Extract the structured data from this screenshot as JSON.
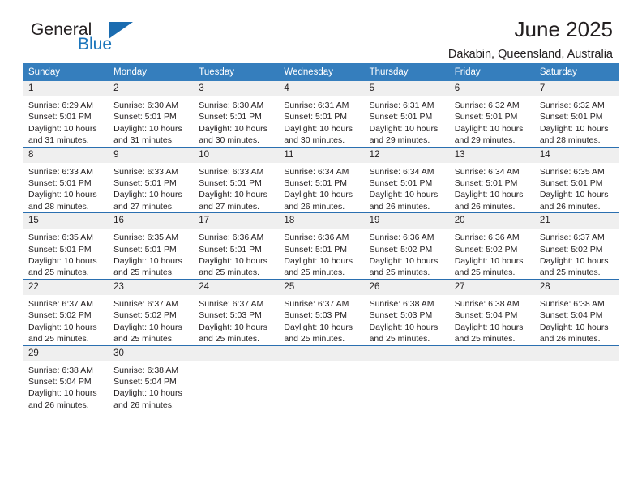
{
  "brand": {
    "word_general": "General",
    "word_blue": "Blue",
    "accent_color": "#1b6cb0"
  },
  "header": {
    "title": "June 2025",
    "subtitle": "Dakabin, Queensland, Australia"
  },
  "calendar": {
    "header_bg": "#357ebd",
    "daynum_bg": "#efefef",
    "weekday_headers": [
      "Sunday",
      "Monday",
      "Tuesday",
      "Wednesday",
      "Thursday",
      "Friday",
      "Saturday"
    ],
    "weeks": [
      [
        {
          "day": "1",
          "sunrise": "Sunrise: 6:29 AM",
          "sunset": "Sunset: 5:01 PM",
          "daylight1": "Daylight: 10 hours",
          "daylight2": "and 31 minutes."
        },
        {
          "day": "2",
          "sunrise": "Sunrise: 6:30 AM",
          "sunset": "Sunset: 5:01 PM",
          "daylight1": "Daylight: 10 hours",
          "daylight2": "and 31 minutes."
        },
        {
          "day": "3",
          "sunrise": "Sunrise: 6:30 AM",
          "sunset": "Sunset: 5:01 PM",
          "daylight1": "Daylight: 10 hours",
          "daylight2": "and 30 minutes."
        },
        {
          "day": "4",
          "sunrise": "Sunrise: 6:31 AM",
          "sunset": "Sunset: 5:01 PM",
          "daylight1": "Daylight: 10 hours",
          "daylight2": "and 30 minutes."
        },
        {
          "day": "5",
          "sunrise": "Sunrise: 6:31 AM",
          "sunset": "Sunset: 5:01 PM",
          "daylight1": "Daylight: 10 hours",
          "daylight2": "and 29 minutes."
        },
        {
          "day": "6",
          "sunrise": "Sunrise: 6:32 AM",
          "sunset": "Sunset: 5:01 PM",
          "daylight1": "Daylight: 10 hours",
          "daylight2": "and 29 minutes."
        },
        {
          "day": "7",
          "sunrise": "Sunrise: 6:32 AM",
          "sunset": "Sunset: 5:01 PM",
          "daylight1": "Daylight: 10 hours",
          "daylight2": "and 28 minutes."
        }
      ],
      [
        {
          "day": "8",
          "sunrise": "Sunrise: 6:33 AM",
          "sunset": "Sunset: 5:01 PM",
          "daylight1": "Daylight: 10 hours",
          "daylight2": "and 28 minutes."
        },
        {
          "day": "9",
          "sunrise": "Sunrise: 6:33 AM",
          "sunset": "Sunset: 5:01 PM",
          "daylight1": "Daylight: 10 hours",
          "daylight2": "and 27 minutes."
        },
        {
          "day": "10",
          "sunrise": "Sunrise: 6:33 AM",
          "sunset": "Sunset: 5:01 PM",
          "daylight1": "Daylight: 10 hours",
          "daylight2": "and 27 minutes."
        },
        {
          "day": "11",
          "sunrise": "Sunrise: 6:34 AM",
          "sunset": "Sunset: 5:01 PM",
          "daylight1": "Daylight: 10 hours",
          "daylight2": "and 26 minutes."
        },
        {
          "day": "12",
          "sunrise": "Sunrise: 6:34 AM",
          "sunset": "Sunset: 5:01 PM",
          "daylight1": "Daylight: 10 hours",
          "daylight2": "and 26 minutes."
        },
        {
          "day": "13",
          "sunrise": "Sunrise: 6:34 AM",
          "sunset": "Sunset: 5:01 PM",
          "daylight1": "Daylight: 10 hours",
          "daylight2": "and 26 minutes."
        },
        {
          "day": "14",
          "sunrise": "Sunrise: 6:35 AM",
          "sunset": "Sunset: 5:01 PM",
          "daylight1": "Daylight: 10 hours",
          "daylight2": "and 26 minutes."
        }
      ],
      [
        {
          "day": "15",
          "sunrise": "Sunrise: 6:35 AM",
          "sunset": "Sunset: 5:01 PM",
          "daylight1": "Daylight: 10 hours",
          "daylight2": "and 25 minutes."
        },
        {
          "day": "16",
          "sunrise": "Sunrise: 6:35 AM",
          "sunset": "Sunset: 5:01 PM",
          "daylight1": "Daylight: 10 hours",
          "daylight2": "and 25 minutes."
        },
        {
          "day": "17",
          "sunrise": "Sunrise: 6:36 AM",
          "sunset": "Sunset: 5:01 PM",
          "daylight1": "Daylight: 10 hours",
          "daylight2": "and 25 minutes."
        },
        {
          "day": "18",
          "sunrise": "Sunrise: 6:36 AM",
          "sunset": "Sunset: 5:01 PM",
          "daylight1": "Daylight: 10 hours",
          "daylight2": "and 25 minutes."
        },
        {
          "day": "19",
          "sunrise": "Sunrise: 6:36 AM",
          "sunset": "Sunset: 5:02 PM",
          "daylight1": "Daylight: 10 hours",
          "daylight2": "and 25 minutes."
        },
        {
          "day": "20",
          "sunrise": "Sunrise: 6:36 AM",
          "sunset": "Sunset: 5:02 PM",
          "daylight1": "Daylight: 10 hours",
          "daylight2": "and 25 minutes."
        },
        {
          "day": "21",
          "sunrise": "Sunrise: 6:37 AM",
          "sunset": "Sunset: 5:02 PM",
          "daylight1": "Daylight: 10 hours",
          "daylight2": "and 25 minutes."
        }
      ],
      [
        {
          "day": "22",
          "sunrise": "Sunrise: 6:37 AM",
          "sunset": "Sunset: 5:02 PM",
          "daylight1": "Daylight: 10 hours",
          "daylight2": "and 25 minutes."
        },
        {
          "day": "23",
          "sunrise": "Sunrise: 6:37 AM",
          "sunset": "Sunset: 5:02 PM",
          "daylight1": "Daylight: 10 hours",
          "daylight2": "and 25 minutes."
        },
        {
          "day": "24",
          "sunrise": "Sunrise: 6:37 AM",
          "sunset": "Sunset: 5:03 PM",
          "daylight1": "Daylight: 10 hours",
          "daylight2": "and 25 minutes."
        },
        {
          "day": "25",
          "sunrise": "Sunrise: 6:37 AM",
          "sunset": "Sunset: 5:03 PM",
          "daylight1": "Daylight: 10 hours",
          "daylight2": "and 25 minutes."
        },
        {
          "day": "26",
          "sunrise": "Sunrise: 6:38 AM",
          "sunset": "Sunset: 5:03 PM",
          "daylight1": "Daylight: 10 hours",
          "daylight2": "and 25 minutes."
        },
        {
          "day": "27",
          "sunrise": "Sunrise: 6:38 AM",
          "sunset": "Sunset: 5:04 PM",
          "daylight1": "Daylight: 10 hours",
          "daylight2": "and 25 minutes."
        },
        {
          "day": "28",
          "sunrise": "Sunrise: 6:38 AM",
          "sunset": "Sunset: 5:04 PM",
          "daylight1": "Daylight: 10 hours",
          "daylight2": "and 26 minutes."
        }
      ],
      [
        {
          "day": "29",
          "sunrise": "Sunrise: 6:38 AM",
          "sunset": "Sunset: 5:04 PM",
          "daylight1": "Daylight: 10 hours",
          "daylight2": "and 26 minutes."
        },
        {
          "day": "30",
          "sunrise": "Sunrise: 6:38 AM",
          "sunset": "Sunset: 5:04 PM",
          "daylight1": "Daylight: 10 hours",
          "daylight2": "and 26 minutes."
        },
        {
          "day": "",
          "sunrise": "",
          "sunset": "",
          "daylight1": "",
          "daylight2": ""
        },
        {
          "day": "",
          "sunrise": "",
          "sunset": "",
          "daylight1": "",
          "daylight2": ""
        },
        {
          "day": "",
          "sunrise": "",
          "sunset": "",
          "daylight1": "",
          "daylight2": ""
        },
        {
          "day": "",
          "sunrise": "",
          "sunset": "",
          "daylight1": "",
          "daylight2": ""
        },
        {
          "day": "",
          "sunrise": "",
          "sunset": "",
          "daylight1": "",
          "daylight2": ""
        }
      ]
    ]
  }
}
